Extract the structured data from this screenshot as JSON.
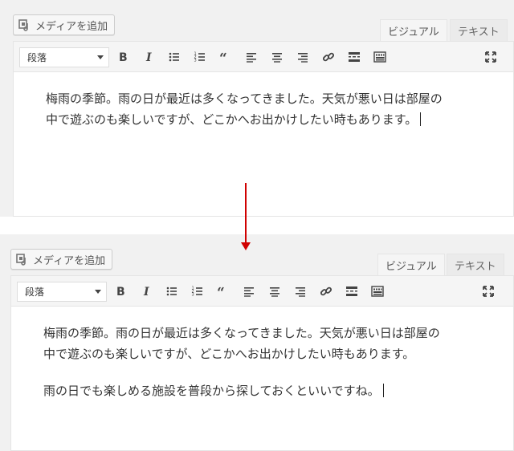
{
  "media_button": {
    "label": "メディアを追加",
    "icon": "media-icon"
  },
  "tabs": {
    "visual": "ビジュアル",
    "text": "テキスト"
  },
  "toolbar": {
    "format_value": "段落",
    "buttons": [
      "bold-icon",
      "italic-icon",
      "bullet-list-icon",
      "numbered-list-icon",
      "blockquote-icon",
      "align-left-icon",
      "align-center-icon",
      "align-right-icon",
      "link-icon",
      "read-more-icon",
      "toolbar-toggle-icon"
    ],
    "fullscreen": "fullscreen-icon"
  },
  "before": {
    "lines": [
      "梅雨の季節。雨の日が最近は多くなってきました。天気が悪い日は部屋の",
      "中で遊ぶのも楽しいですが、どこかへお出かけしたい時もあります。"
    ]
  },
  "after": {
    "lines": [
      "梅雨の季節。雨の日が最近は多くなってきました。天気が悪い日は部屋の",
      "中で遊ぶのも楽しいですが、どこかへお出かけしたい時もあります。"
    ],
    "new_paragraph": "雨の日でも楽しめる施設を普段から探しておくといいですね。"
  },
  "colors": {
    "arrow": "#d00000",
    "panel_bg": "#f1f1f1",
    "text": "#333333"
  }
}
